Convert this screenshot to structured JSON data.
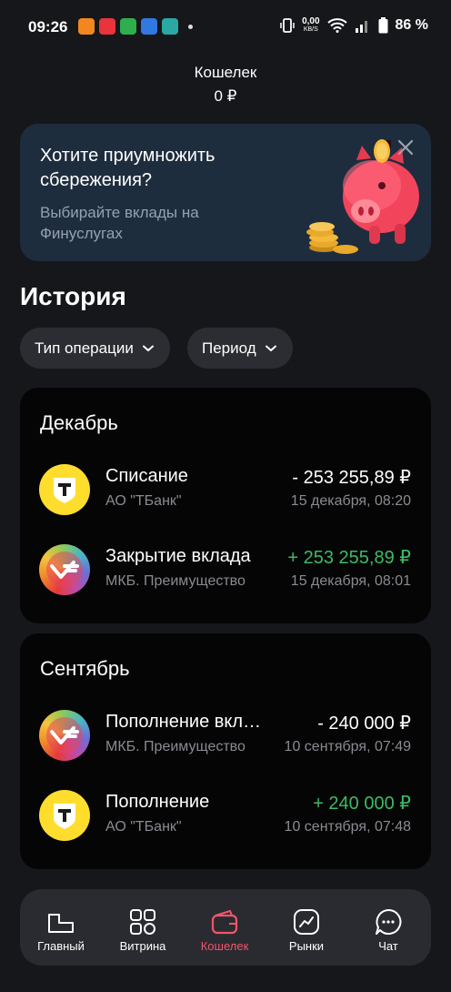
{
  "status_bar": {
    "time": "09:26",
    "net_speed": "0,00",
    "net_unit": "KB/S",
    "battery": "86 %"
  },
  "header": {
    "title": "Кошелек",
    "balance": "0 ₽"
  },
  "promo": {
    "title": "Хотите приумножить сбережения?",
    "subtitle": "Выбирайте вклады на Финуслугах",
    "close_icon": "close-icon",
    "image": "piggy-bank-illustration"
  },
  "history": {
    "title": "История",
    "filters": [
      {
        "label": "Тип операции",
        "icon": "chevron-down-icon"
      },
      {
        "label": "Период",
        "icon": "chevron-down-icon"
      }
    ],
    "groups": [
      {
        "month": "Декабрь",
        "items": [
          {
            "name": "Списание",
            "counterparty": "АО \"ТБанк\"",
            "amount": "- 253 255,89 ₽",
            "date": "15 декабря, 08:20",
            "positive": false,
            "icon": "tbank-logo"
          },
          {
            "name": "Закрытие вклада",
            "counterparty": "МКБ. Преимущество",
            "amount": "+ 253 255,89 ₽",
            "date": "15 декабря, 08:01",
            "positive": true,
            "icon": "mkb-logo"
          }
        ]
      },
      {
        "month": "Сентябрь",
        "items": [
          {
            "name": "Пополнение вклада",
            "counterparty": "МКБ. Преимущество",
            "amount": "- 240 000 ₽",
            "date": "10 сентября, 07:49",
            "positive": false,
            "icon": "mkb-logo"
          },
          {
            "name": "Пополнение",
            "counterparty": "АО \"ТБанк\"",
            "amount": "+ 240 000 ₽",
            "date": "10 сентября, 07:48",
            "positive": true,
            "icon": "tbank-logo"
          }
        ]
      }
    ]
  },
  "nav": {
    "items": [
      {
        "label": "Главный",
        "icon": "home-icon",
        "active": false
      },
      {
        "label": "Витрина",
        "icon": "grid-icon",
        "active": false
      },
      {
        "label": "Кошелек",
        "icon": "wallet-icon",
        "active": true
      },
      {
        "label": "Рынки",
        "icon": "chart-icon",
        "active": false
      },
      {
        "label": "Чат",
        "icon": "chat-icon",
        "active": false
      }
    ]
  },
  "colors": {
    "background": "#16171b",
    "card": "#050506",
    "positive": "#3dbb63",
    "active_nav": "#f0566a",
    "promo_bg": "#1e2d3e"
  }
}
